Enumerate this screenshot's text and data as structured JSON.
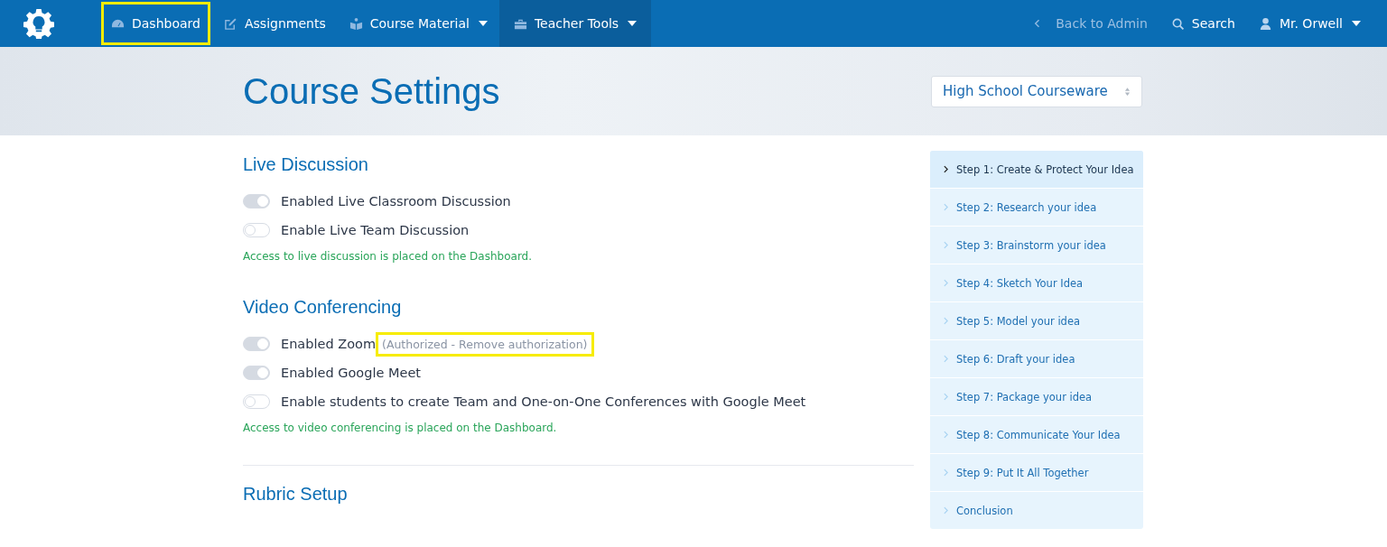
{
  "nav": {
    "left": [
      {
        "label": "Dashboard",
        "kind": "gauge",
        "dropdown": false,
        "selected": false,
        "highlighted": true
      },
      {
        "label": "Assignments",
        "kind": "edit",
        "dropdown": false,
        "selected": false,
        "highlighted": false
      },
      {
        "label": "Course Material",
        "kind": "book",
        "dropdown": true,
        "selected": false,
        "highlighted": false
      },
      {
        "label": "Teacher Tools",
        "kind": "toolbox",
        "dropdown": true,
        "selected": true,
        "highlighted": false
      }
    ],
    "right": [
      {
        "label": "Back to Admin",
        "kind": "back",
        "dropdown": false,
        "muted": true
      },
      {
        "label": "Search",
        "kind": "search",
        "dropdown": false,
        "muted": false
      },
      {
        "label": "Mr. Orwell",
        "kind": "user",
        "dropdown": true,
        "muted": false
      }
    ]
  },
  "header": {
    "title": "Course Settings",
    "course_select": {
      "value": "High School Courseware"
    }
  },
  "sections": [
    {
      "title": "Live Discussion",
      "toggles": [
        {
          "label": "Enabled Live Classroom Discussion",
          "on": true
        },
        {
          "label": "Enable Live Team Discussion",
          "on": false
        }
      ],
      "note": "Access to live discussion is placed on the Dashboard."
    },
    {
      "title": "Video Conferencing",
      "toggles": [
        {
          "label": "Enabled Zoom",
          "on": true,
          "status": "(Authorized - Remove authorization)",
          "highlighted": true
        },
        {
          "label": "Enabled Google Meet",
          "on": true
        },
        {
          "label": "Enable students to create Team and One-on-One Conferences with Google Meet",
          "on": false
        }
      ],
      "note": "Access to video conferencing is placed on the Dashboard."
    },
    {
      "title": "Rubric Setup"
    }
  ],
  "steps": [
    {
      "label": "Step 1: Create & Protect Your Idea",
      "selected": true
    },
    {
      "label": "Step 2: Research your idea",
      "selected": false
    },
    {
      "label": "Step 3: Brainstorm your idea",
      "selected": false
    },
    {
      "label": "Step 4: Sketch Your Idea",
      "selected": false
    },
    {
      "label": "Step 5: Model your idea",
      "selected": false
    },
    {
      "label": "Step 6: Draft your idea",
      "selected": false
    },
    {
      "label": "Step 7: Package your idea",
      "selected": false
    },
    {
      "label": "Step 8: Communicate Your Idea",
      "selected": false
    },
    {
      "label": "Step 9: Put It All Together",
      "selected": false
    },
    {
      "label": "Conclusion",
      "selected": false
    }
  ]
}
